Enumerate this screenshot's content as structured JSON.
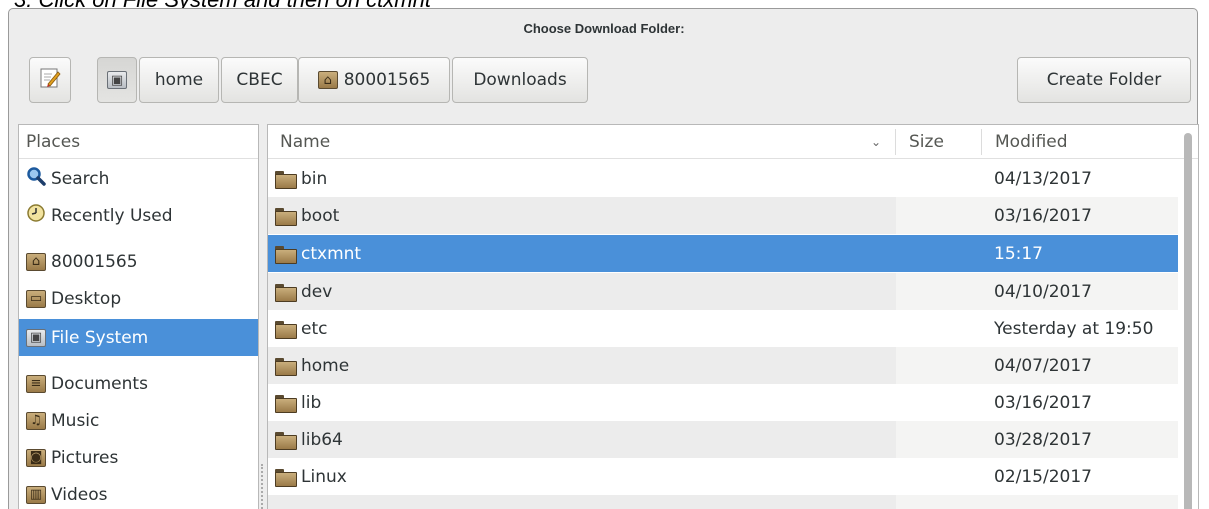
{
  "caption": "3.  Click on File System and then on ctxmnt",
  "dialog": {
    "title": "Choose Download Folder:",
    "path_bar": {
      "edit_icon": "pencil-edit-icon",
      "buttons": [
        {
          "label": "",
          "icon": "filesystem-icon"
        },
        {
          "label": "home"
        },
        {
          "label": "CBEC"
        },
        {
          "label": "80001565",
          "icon": "home-folder-icon"
        },
        {
          "label": "Downloads"
        }
      ]
    },
    "create_folder_label": "Create Folder"
  },
  "places": {
    "header": "Places",
    "items": [
      {
        "label": "Search",
        "icon": "search-icon"
      },
      {
        "label": "Recently Used",
        "icon": "clock-icon"
      },
      {
        "label": "80001565",
        "icon": "home-folder-icon"
      },
      {
        "label": "Desktop",
        "icon": "desktop-folder-icon"
      },
      {
        "label": "File System",
        "icon": "filesystem-icon",
        "selected": true
      },
      {
        "label": "Documents",
        "icon": "documents-folder-icon"
      },
      {
        "label": "Music",
        "icon": "music-folder-icon"
      },
      {
        "label": "Pictures",
        "icon": "pictures-folder-icon"
      },
      {
        "label": "Videos",
        "icon": "videos-folder-icon"
      }
    ]
  },
  "files": {
    "columns": {
      "name": "Name",
      "size": "Size",
      "modified": "Modified"
    },
    "rows": [
      {
        "name": "bin",
        "size": "",
        "modified": "04/13/2017"
      },
      {
        "name": "boot",
        "size": "",
        "modified": "03/16/2017"
      },
      {
        "name": "ctxmnt",
        "size": "",
        "modified": "15:17",
        "selected": true
      },
      {
        "name": "dev",
        "size": "",
        "modified": "04/10/2017"
      },
      {
        "name": "etc",
        "size": "",
        "modified": "Yesterday at 19:50"
      },
      {
        "name": "home",
        "size": "",
        "modified": "04/07/2017"
      },
      {
        "name": "lib",
        "size": "",
        "modified": "03/16/2017"
      },
      {
        "name": "lib64",
        "size": "",
        "modified": "03/28/2017"
      },
      {
        "name": "Linux",
        "size": "",
        "modified": "02/15/2017"
      }
    ]
  },
  "colors": {
    "selection": "#4a90d9",
    "dialog_bg": "#ededed"
  }
}
